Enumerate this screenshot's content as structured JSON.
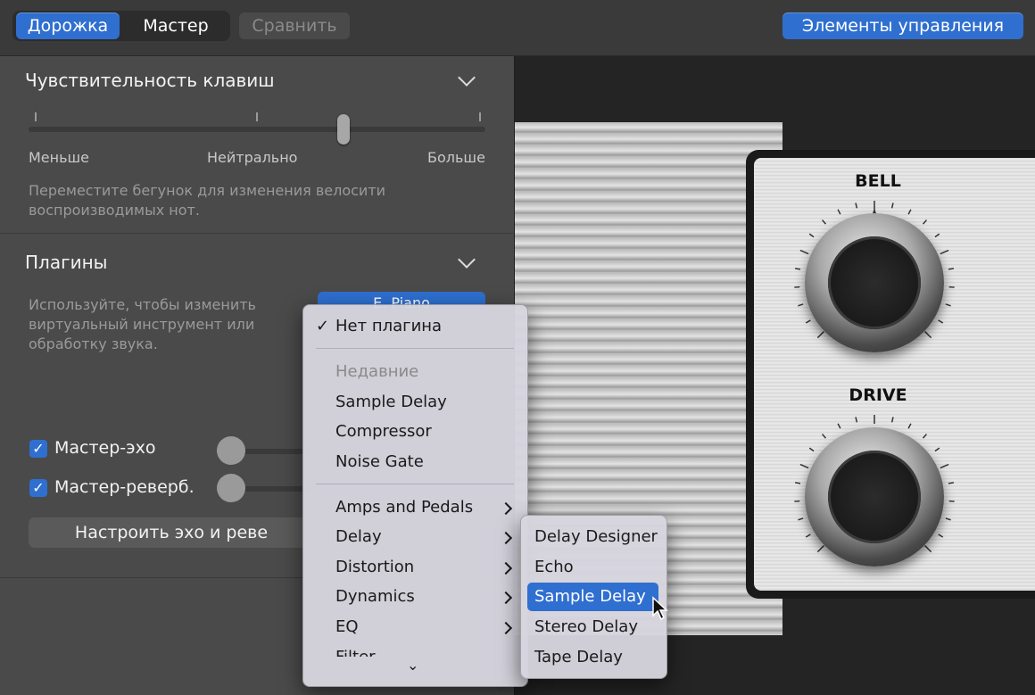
{
  "header": {
    "tabs": [
      {
        "label": "Дорожка",
        "selected": true
      },
      {
        "label": "Мастер",
        "selected": false
      }
    ],
    "compare_label": "Сравнить",
    "controls_label": "Элементы управления"
  },
  "keys_section": {
    "title": "Чувствительность клавиш",
    "slider_value": 0.69,
    "labels": {
      "less": "Меньше",
      "neutral": "Нейтрально",
      "more": "Больше"
    },
    "hint": "Переместите бегунок для изменения велосити воспроизводимых нот."
  },
  "plugins_section": {
    "title": "Плагины",
    "hint": "Используйте, чтобы изменить виртуальный инструмент или обработку звука.",
    "instrument_button": "E. Piano",
    "echo_label": "Мастер-эхо",
    "reverb_label": "Мастер-реверб.",
    "configure_label": "Настроить эхо и реве"
  },
  "menu": {
    "no_plugin": "Нет плагина",
    "check": "✓",
    "recent_header": "Недавние",
    "recent": [
      "Sample Delay",
      "Compressor",
      "Noise Gate"
    ],
    "categories": [
      "Amps and Pedals",
      "Delay",
      "Distortion",
      "Dynamics",
      "EQ",
      "Filter"
    ],
    "more_glyph": "⌄"
  },
  "submenu": {
    "items": [
      "Delay Designer",
      "Echo",
      "Sample Delay",
      "Stereo Delay",
      "Tape Delay"
    ],
    "selected": "Sample Delay"
  },
  "amp": {
    "knob1_label": "BELL",
    "knob2_label": "DRIVE"
  },
  "colors": {
    "accent": "#2f6fd0",
    "panel": "#4a4a4a",
    "topbar": "#3a3a3a"
  }
}
